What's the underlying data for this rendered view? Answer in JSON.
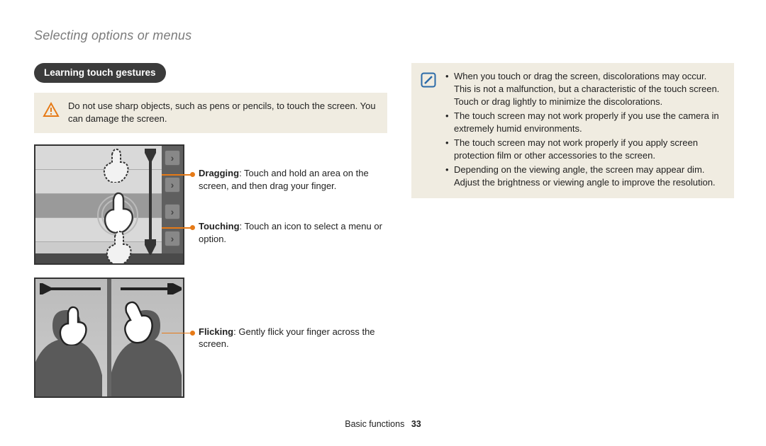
{
  "heading": "Selecting options or menus",
  "section_badge": "Learning touch gestures",
  "warning_text": "Do not use sharp objects, such as pens or pencils, to touch the screen. You can damage the screen.",
  "gesture1": {
    "dragging": {
      "term": "Dragging",
      "text": ": Touch and hold an area on the screen, and then drag your finger."
    },
    "touching": {
      "term": "Touching",
      "text": ": Touch an icon to select a menu or option."
    }
  },
  "gesture2": {
    "flicking": {
      "term": "Flicking",
      "text": ": Gently flick your finger across the screen."
    }
  },
  "note_bullets": [
    "When you touch or drag the screen, discolorations may occur. This is not a malfunction, but a characteristic of the touch screen. Touch or drag lightly to minimize the discolorations.",
    "The touch screen may not work properly if you use the camera in extremely humid environments.",
    "The touch screen may not work properly if you apply screen protection film or other accessories to the screen.",
    "Depending on the viewing angle, the screen may appear dim. Adjust the brightness or viewing angle to improve the resolution."
  ],
  "footer": {
    "section": "Basic functions",
    "page": "33"
  }
}
